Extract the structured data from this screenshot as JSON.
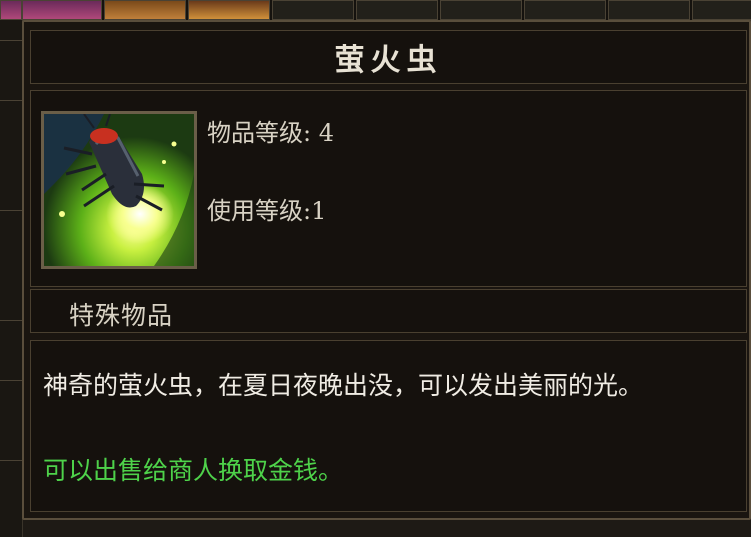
{
  "tooltip": {
    "item_name": "萤火虫",
    "item_level_label": "物品等级: ",
    "item_level_value": "4",
    "use_level_label": "使用等级:",
    "use_level_value": "1",
    "category": "特殊物品",
    "description": "神奇的萤火虫，在夏日夜晚出没，可以发出美丽的光。",
    "sell_hint": "可以出售给商人换取金钱。",
    "icon": "firefly-icon"
  },
  "colors": {
    "title": "#e8e2d4",
    "description": "#f0ece4",
    "sell_hint": "#4ed24a",
    "border": "#5a4e3c"
  }
}
